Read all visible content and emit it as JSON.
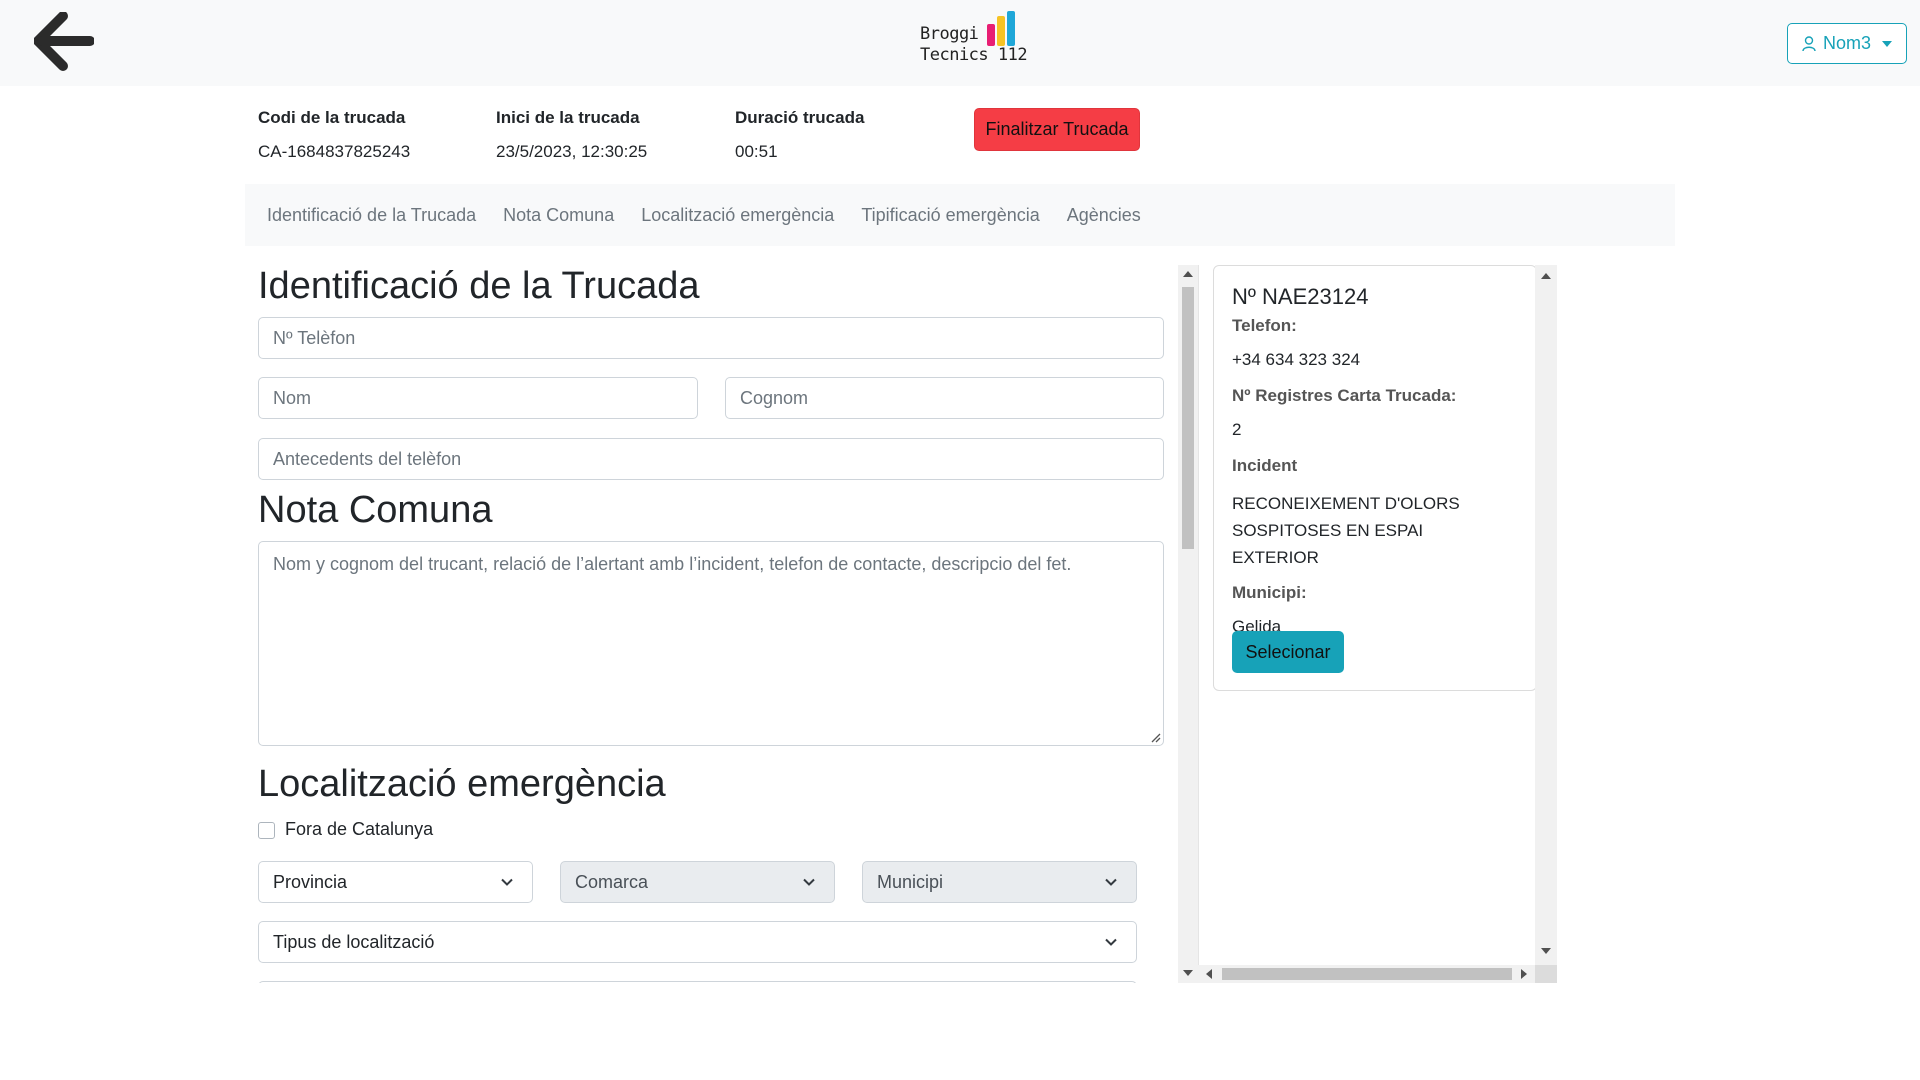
{
  "header": {
    "logo_text": "Broggi\nTecnics 112",
    "user_label": "Nom3",
    "colors": {
      "accent": "#17a2b8",
      "danger": "#f53d45"
    }
  },
  "call_info": {
    "code_label": "Codi de la trucada",
    "code_value": "CA-1684837825243",
    "start_label": "Inici de la trucada",
    "start_value": "23/5/2023, 12:30:25",
    "duration_label": "Duració trucada",
    "duration_value": "00:51",
    "end_button": "Finalitzar Trucada"
  },
  "nav": {
    "items": [
      {
        "label": "Identificació de la Trucada"
      },
      {
        "label": "Nota Comuna"
      },
      {
        "label": "Localització emergència"
      },
      {
        "label": "Tipificació emergència"
      },
      {
        "label": "Agències"
      }
    ]
  },
  "identification": {
    "title": "Identificació de la Trucada",
    "phone_placeholder": "Nº Telèfon",
    "name_placeholder": "Nom",
    "surname_placeholder": "Cognom",
    "history_placeholder": "Antecedents del telèfon"
  },
  "note": {
    "title": "Nota Comuna",
    "placeholder": "Nom y cognom del trucant, relació de l’alertant amb l’incident, telefon de contacte, descripcio del fet."
  },
  "location": {
    "title": "Localització emergència",
    "outside_label": "Fora de Catalunya",
    "province_selected": "Provincia",
    "comarca_selected": "Comarca",
    "municipi_selected": "Municipi",
    "type_selected": "Tipus de localització"
  },
  "record_card": {
    "title": "Nº NAE23124",
    "phone_label": "Telefon:",
    "phone_value": "+34 634 323 324",
    "records_label": "Nº Registres Carta Trucada:",
    "records_value": "2",
    "incident_label": "Incident",
    "incident_value": "RECONEIXEMENT D'OLORS SOSPITOSES EN ESPAI EXTERIOR",
    "municipi_label": "Municipi:",
    "municipi_value": "Gelida",
    "select_button": "Selecionar"
  }
}
